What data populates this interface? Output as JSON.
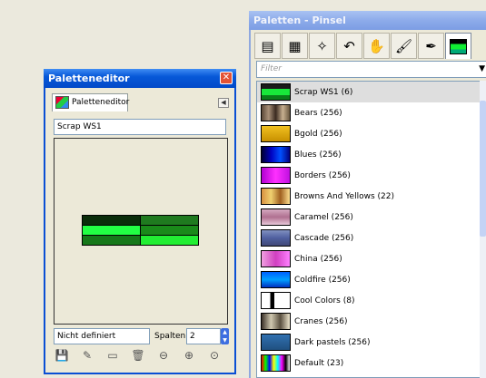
{
  "editor": {
    "title": "Paletteneditor",
    "tab_label": "Paletteneditor",
    "palette_name": "Scrap WS1",
    "color_name": "Nicht definiert",
    "columns_label": "Spalten:",
    "columns_value": "2",
    "swatches": [
      "#0a2d0a",
      "#1f7a1f",
      "#22ff44",
      "#1a8a1a",
      "#16781a",
      "#22ee33"
    ]
  },
  "palettes": {
    "title": "Paletten - Pinsel",
    "filter_placeholder": "Filter",
    "items": [
      {
        "label": "Scrap WS1 (6)",
        "selected": true,
        "bg": "linear-gradient(#1a1a1a 0 30%, #18e83a 30% 70%, #0a7d1a 70%)"
      },
      {
        "label": "Bears (256)",
        "bg": "linear-gradient(90deg,#5a4838,#a89078,#3a2a20,#c8b090,#6a5840)"
      },
      {
        "label": "Bgold (256)",
        "bg": "linear-gradient(#f0c020,#c89000)"
      },
      {
        "label": "Blues (256)",
        "bg": "linear-gradient(90deg,#000030,#0000c0,#0050ff,#000080)"
      },
      {
        "label": "Borders (256)",
        "bg": "linear-gradient(90deg,#b000d0,#ff30ff,#c010e0)"
      },
      {
        "label": "Browns And Yellows (22)",
        "bg": "linear-gradient(90deg,#d89040,#f0d070,#a06020,#ffe090)"
      },
      {
        "label": "Caramel (256)",
        "bg": "linear-gradient(#d4a8c0,#b07090,#e8c8d8)"
      },
      {
        "label": "Cascade (256)",
        "bg": "linear-gradient(#8090c0,#5060a0,#404878)"
      },
      {
        "label": "China (256)",
        "bg": "linear-gradient(90deg,#f0a0e0,#d040c0,#ff80ff)"
      },
      {
        "label": "Coldfire (256)",
        "bg": "linear-gradient(#0060ff,#00a0ff,#0030c0)"
      },
      {
        "label": "Cool Colors (8)",
        "bg": "linear-gradient(90deg,#fff 0 30%,#000 30% 45%,#fff 45%)"
      },
      {
        "label": "Cranes (256)",
        "bg": "linear-gradient(90deg,#3a3028,#d0c8b0,#5a5040,#f0e8d0)"
      },
      {
        "label": "Dark pastels (256)",
        "bg": "linear-gradient(#3070b0,#205080)"
      },
      {
        "label": "Default (23)",
        "bg": "linear-gradient(90deg,#f00,#0f0,#00f,#ff0,#0ff,#f0f,#000,#fff)"
      }
    ]
  }
}
